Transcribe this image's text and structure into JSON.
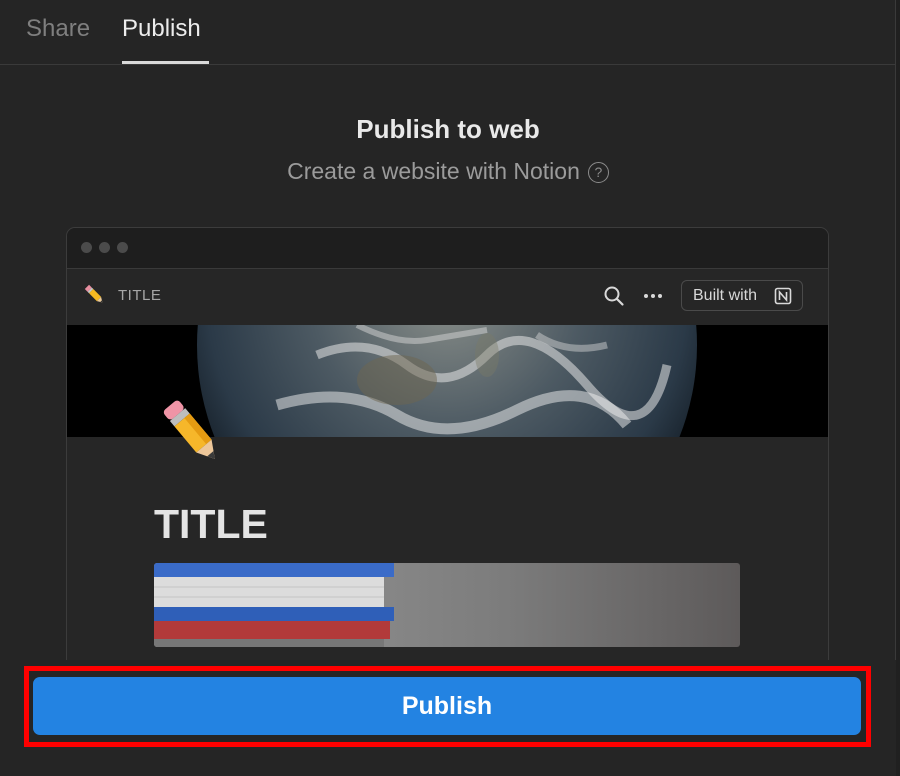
{
  "tabs": [
    {
      "label": "Share",
      "active": false
    },
    {
      "label": "Publish",
      "active": true
    }
  ],
  "publish_to_web": {
    "title": "Publish to web",
    "subtitle": "Create a website with Notion",
    "help_icon": "question-circle-icon"
  },
  "preview": {
    "page_emoji": "pencil-icon",
    "header_title": "TITLE",
    "built_with_label": "Built with",
    "built_with_logo": "notion-logo-icon",
    "cover_image": "earth-image",
    "page_title": "TITLE",
    "content_image": "books-image"
  },
  "publish_button": {
    "label": "Publish",
    "color": "#2383e2",
    "highlight_color": "#ff0000"
  }
}
